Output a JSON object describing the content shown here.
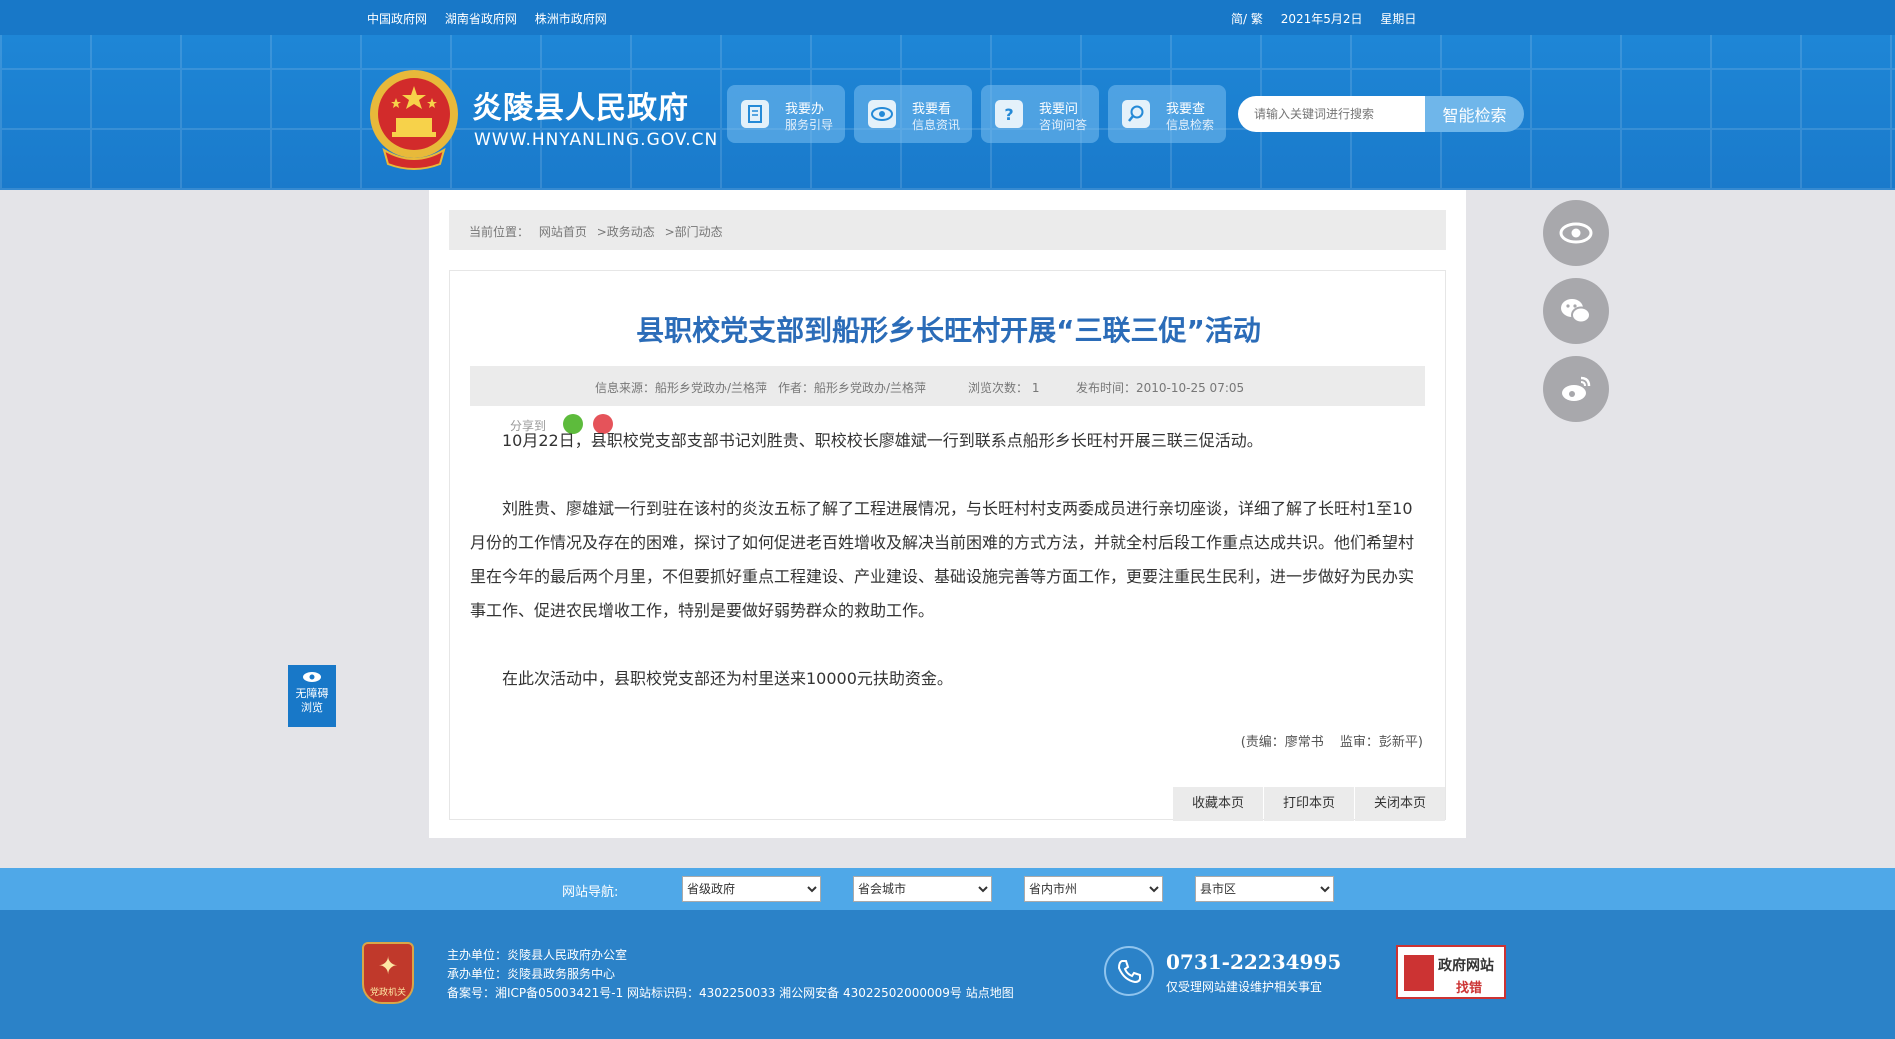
{
  "topbar": {
    "links": [
      "中国政府网",
      "湖南省政府网",
      "株洲市政府网"
    ],
    "lang": "简/ 繁",
    "date": "2021年5月2日",
    "weekday": "星期日"
  },
  "header": {
    "title": "炎陵县人民政府",
    "url": "WWW.HNYANLING.GOV.CN",
    "quick": [
      {
        "l1": "我要办",
        "l2": "服务引导",
        "icon": "document-icon"
      },
      {
        "l1": "我要看",
        "l2": "信息资讯",
        "icon": "eye-icon"
      },
      {
        "l1": "我要问",
        "l2": "咨询问答",
        "icon": "question-icon"
      },
      {
        "l1": "我要查",
        "l2": "信息检索",
        "icon": "search-icon"
      }
    ],
    "search_placeholder": "请输入关键词进行搜索",
    "search_button": "智能检索"
  },
  "breadcrumb": {
    "prefix": "当前位置：",
    "items": [
      "网站首页",
      ">政务动态",
      ">部门动态"
    ]
  },
  "article": {
    "title": "县职校党支部到船形乡长旺村开展“三联三促”活动",
    "source": "信息来源：船形乡党政办/兰格萍",
    "author": "作者：船形乡党政办/兰格萍",
    "views": "浏览次数：  1",
    "published": "发布时间：2010-10-25 07:05",
    "share_label": "分享到",
    "paragraphs": [
      "10月22日，县职校党支部支部书记刘胜贵、职校校长廖雄斌一行到联系点船形乡长旺村开展三联三促活动。",
      "刘胜贵、廖雄斌一行到驻在该村的炎汝五标了解了工程进展情况，与长旺村村支两委成员进行亲切座谈，详细了解了长旺村1至10月份的工作情况及存在的困难，探讨了如何促进老百姓增收及解决当前困难的方式方法，并就全村后段工作重点达成共识。他们希望村里在今年的最后两个月里，不但要抓好重点工程建设、产业建设、基础设施完善等方面工作，更要注重民生民利，进一步做好为民办实事工作、促进农民增收工作，特别是要做好弱势群众的救助工作。",
      "在此次活动中，县职校党支部还为村里送来10000元扶助资金。"
    ],
    "editor": "(责编：廖常书",
    "reviewer": "监审：彭新平)",
    "buttons": [
      "收藏本页",
      "打印本页",
      "关闭本页"
    ]
  },
  "floating": [
    "eye-icon",
    "wechat-icon",
    "weibo-icon"
  ],
  "accessibility": {
    "l1": "无障碍",
    "l2": "浏览"
  },
  "navbar": {
    "label": "网站导航:",
    "selects": [
      "省级政府",
      "省会城市",
      "省内市州",
      "县市区"
    ]
  },
  "footer": {
    "badge_top": "党政机关",
    "line1": "主办单位：炎陵县人民政府办公室",
    "line2": "承办单位：炎陵县政务服务中心",
    "line3": "备案号：湘ICP备05003421号-1 网站标识码：4302250033 湘公网安备 43022502000009号 站点地图",
    "phone": "0731-22234995",
    "phone_note": "仅受理网站建设维护相关事宜",
    "error_l1": "政府网站",
    "error_l2": "找错"
  },
  "colors": {
    "brand": "#1878c8",
    "title": "#2b6cb8",
    "navbar": "#4fa8e8",
    "footer": "#2b82c8"
  }
}
